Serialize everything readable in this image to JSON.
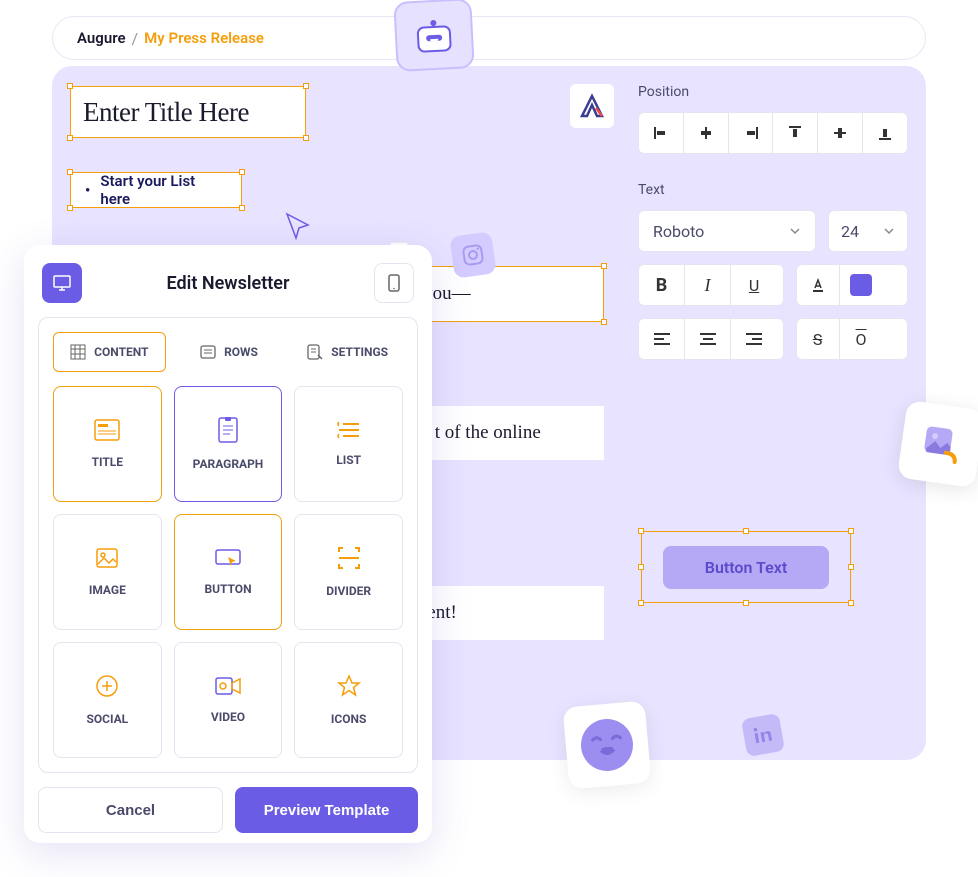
{
  "breadcrumb": {
    "app": "Augure",
    "sep": "/",
    "page": "My Press Release"
  },
  "canvas": {
    "title_placeholder": "Enter Title Here",
    "list_placeholder": "Start your List here",
    "para1": "vigate the ever-share the latest d can propel you—",
    "para2": "en hard at work rom harnessing zardry, we're t of the online",
    "para3": "—our valued success stories collaborative ment!"
  },
  "right_panel": {
    "position_label": "Position",
    "text_label": "Text",
    "font": "Roboto",
    "size": "24"
  },
  "button_preview": {
    "label": "Button Text"
  },
  "newsletter": {
    "title": "Edit Newsletter",
    "tabs": {
      "content": "CONTENT",
      "rows": "ROWS",
      "settings": "SETTINGS"
    },
    "items": {
      "title": "TITLE",
      "paragraph": "PARAGRAPH",
      "list": "LIST",
      "image": "IMAGE",
      "button": "BUTTON",
      "divider": "DIVIDER",
      "social": "SOCIAL",
      "video": "VIDEO",
      "icons": "ICONS"
    },
    "cancel": "Cancel",
    "preview": "Preview Template"
  }
}
